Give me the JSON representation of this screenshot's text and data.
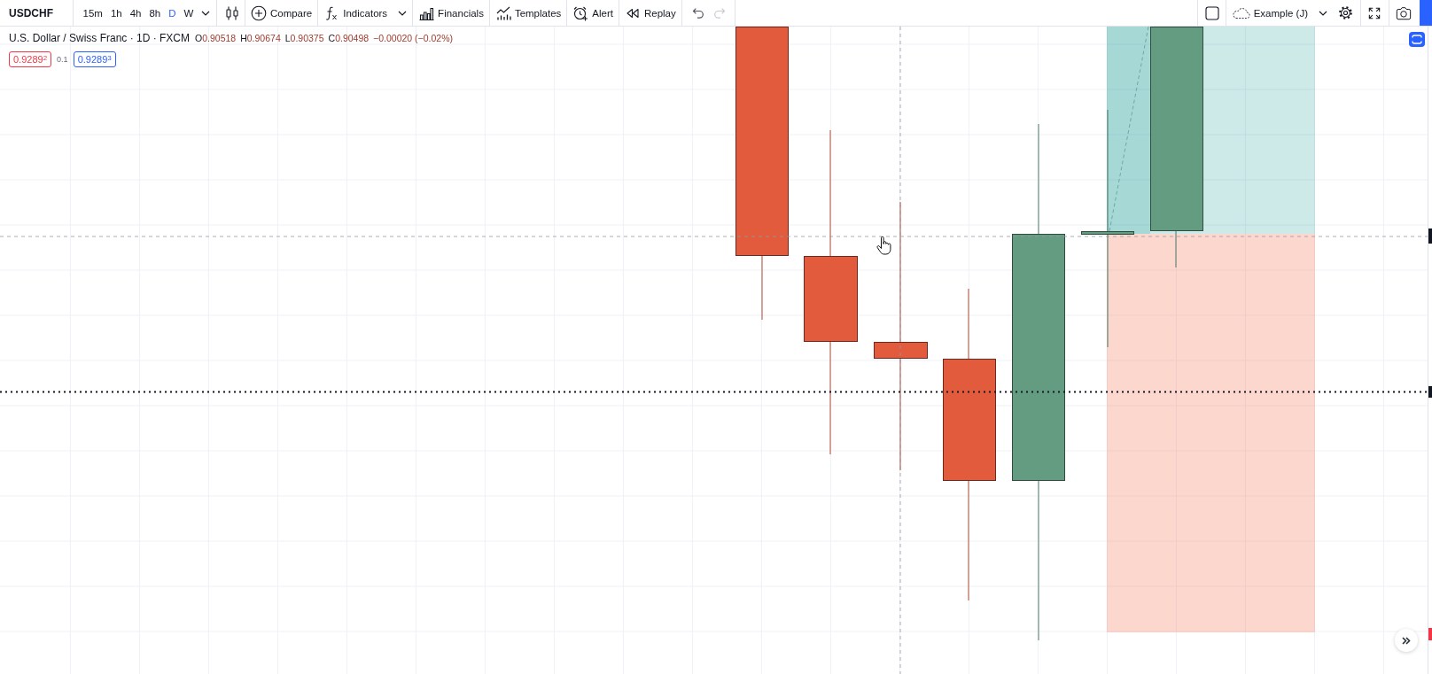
{
  "toolbar": {
    "symbol": "USDCHF",
    "intervals": [
      {
        "label": "15m",
        "selected": false
      },
      {
        "label": "1h",
        "selected": false
      },
      {
        "label": "4h",
        "selected": false
      },
      {
        "label": "8h",
        "selected": false
      },
      {
        "label": "D",
        "selected": true
      },
      {
        "label": "W",
        "selected": false
      }
    ],
    "tools": [
      {
        "kind": "compare",
        "label": "Compare"
      },
      {
        "kind": "indicators",
        "label": "Indicators"
      },
      {
        "kind": "financials",
        "label": "Financials"
      },
      {
        "kind": "templates",
        "label": "Templates"
      },
      {
        "kind": "alert",
        "label": "Alert"
      },
      {
        "kind": "replay",
        "label": "Replay"
      }
    ],
    "undo": {
      "disabled": false
    },
    "redo": {
      "disabled": true
    },
    "layout_name": "Example (J)"
  },
  "legend": {
    "title": "U.S. Dollar / Swiss Franc · 1D · FXCM",
    "ohlc": [
      {
        "label": "O",
        "value": "0.90518"
      },
      {
        "label": "H",
        "value": "0.90674"
      },
      {
        "label": "L",
        "value": "0.90375"
      },
      {
        "label": "C",
        "value": "0.90498"
      }
    ],
    "change": "−0.00020 (−0.02%)",
    "sell_price": "0.9289$^{2}$",
    "spread": "0.1",
    "buy_price": "0.9289$^{3}$"
  }
}
